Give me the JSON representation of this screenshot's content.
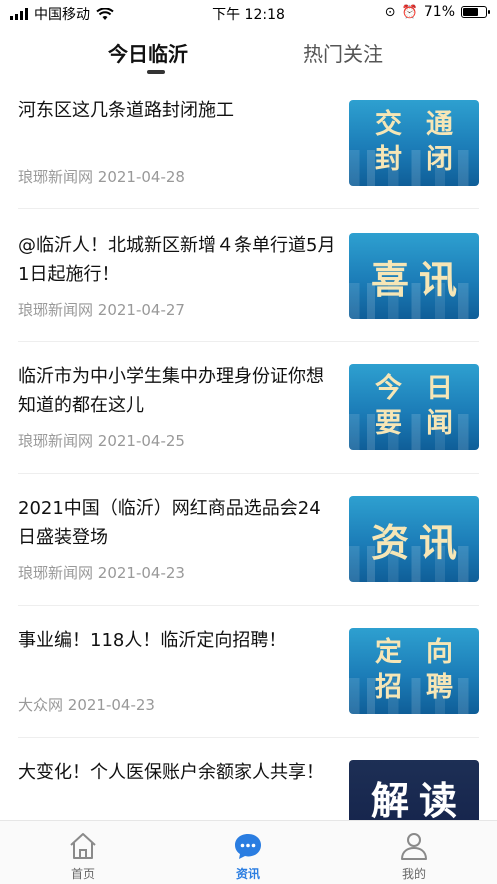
{
  "status_bar": {
    "carrier": "中国移动",
    "time": "下午 12:18",
    "battery": "71%",
    "battery_level": 0.71
  },
  "tabs": [
    {
      "label": "今日临沂",
      "active": true
    },
    {
      "label": "热门关注",
      "active": false
    }
  ],
  "feed": [
    {
      "title": "河东区这几条道路封闭施工",
      "source": "琅琊新闻网",
      "date": "2021-04-28",
      "thumb_text": [
        "交",
        "通",
        "封",
        "闭"
      ]
    },
    {
      "title": "@临沂人！北城新区新增４条单行道5月1日起施行！",
      "source": "琅琊新闻网",
      "date": "2021-04-27",
      "thumb_text": [
        "喜",
        "讯"
      ]
    },
    {
      "title": "临沂市为中小学生集中办理身份证你想知道的都在这儿",
      "source": "琅琊新闻网",
      "date": "2021-04-25",
      "thumb_text": [
        "今",
        "日",
        "要",
        "闻"
      ]
    },
    {
      "title": "2021中国（临沂）网红商品选品会24日盛装登场",
      "source": "琅琊新闻网",
      "date": "2021-04-23",
      "thumb_text": [
        "资",
        "讯"
      ]
    },
    {
      "title": "事业编！118人！临沂定向招聘！",
      "source": "大众网",
      "date": "2021-04-23",
      "thumb_text": [
        "定",
        "向",
        "招",
        "聘"
      ]
    },
    {
      "title": "大变化！个人医保账户余额家人共享！",
      "source": "",
      "date": "",
      "thumb_text": [
        "解",
        "读"
      ]
    }
  ],
  "bottom_nav": [
    {
      "label": "首页",
      "icon": "home-icon",
      "active": false
    },
    {
      "label": "资讯",
      "icon": "chat-bubble-icon",
      "active": true
    },
    {
      "label": "我的",
      "icon": "user-icon",
      "active": false
    }
  ],
  "colors": {
    "accent": "#2a7de1",
    "thumb_blue": "#1c7db8",
    "thumb_text": "#f6e6b6"
  }
}
